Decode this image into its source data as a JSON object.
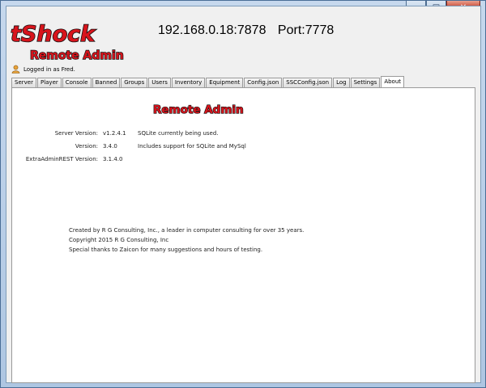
{
  "window": {
    "controls": [
      "–",
      "□",
      "✕"
    ]
  },
  "logo": {
    "text_main": "tShock",
    "text_sub": "Remote Admin"
  },
  "connection": {
    "address": "192.168.0.18:7878",
    "port_label": "Port:7778"
  },
  "login": {
    "text": "Logged in as Fred."
  },
  "tabs": [
    {
      "label": "Server"
    },
    {
      "label": "Player"
    },
    {
      "label": "Console"
    },
    {
      "label": "Banned"
    },
    {
      "label": "Groups"
    },
    {
      "label": "Users"
    },
    {
      "label": "Inventory"
    },
    {
      "label": "Equipment"
    },
    {
      "label": "Config.json"
    },
    {
      "label": "SSCConfig.json"
    },
    {
      "label": "Log"
    },
    {
      "label": "Settings"
    },
    {
      "label": "About"
    }
  ],
  "about": {
    "title": "Remote Admin",
    "rows": [
      {
        "label": "Server Version:",
        "value": "v1.2.4.1",
        "note": "SQLite currently being used."
      },
      {
        "label": "Version:",
        "value": "3.4.0",
        "note": "Includes support for SQLite and MySql"
      },
      {
        "label": "ExtraAdminREST Version:",
        "value": "3.1.4.0",
        "note": ""
      }
    ],
    "credits": [
      "Created by R G Consulting, Inc., a leader in computer consulting for over 35 years.",
      "Copyright 2015 R G Consulting, Inc",
      "Special thanks to Zaicon for many suggestions and hours of testing."
    ]
  },
  "colors": {
    "logo_red": "#d8141c",
    "logo_outline": "#111111",
    "tab_active": "#ffffff",
    "window_frame": "#b9d1ea"
  }
}
